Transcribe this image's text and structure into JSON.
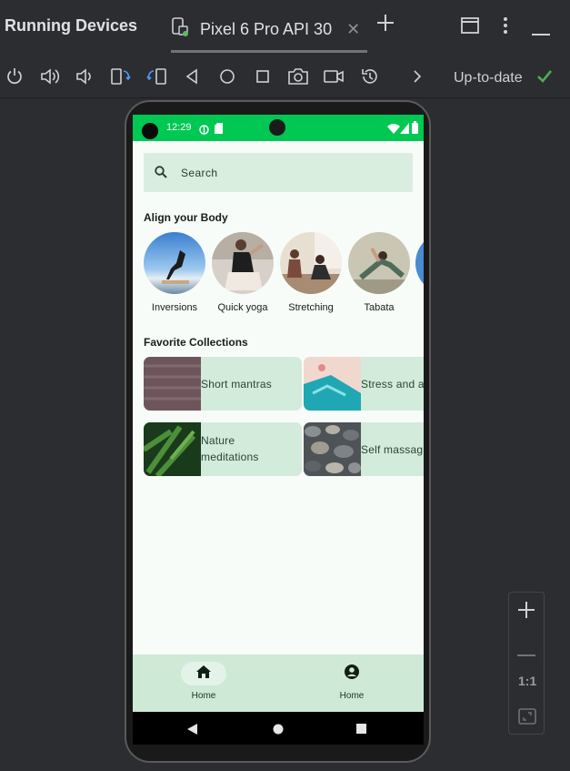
{
  "window": {
    "title": "Running Devices",
    "tab_label": "Pixel 6 Pro API 30",
    "status": "Up-to-date"
  },
  "toolbar": {
    "icons": [
      "power-icon",
      "volume-up-icon",
      "volume-down-icon",
      "rotate-left-icon",
      "rotate-right-icon",
      "back-icon",
      "home-icon",
      "overview-icon",
      "camera-icon",
      "video-icon",
      "reset-icon",
      "chevron-right-icon"
    ],
    "accent_check": "#4caf50"
  },
  "phone": {
    "status_time": "12:29",
    "status_color": "#00c853",
    "search": {
      "placeholder": "Search"
    },
    "section_align": "Align your Body",
    "align_items": [
      {
        "label": "Inversions"
      },
      {
        "label": "Quick yoga"
      },
      {
        "label": "Stretching"
      },
      {
        "label": "Tabata"
      }
    ],
    "section_collections": "Favorite Collections",
    "collections": [
      {
        "label": "Short mantras"
      },
      {
        "label": "Stress and a"
      },
      {
        "label": "Nature meditations"
      },
      {
        "label": "Self massag"
      }
    ],
    "bottom_nav": [
      {
        "label": "Home"
      },
      {
        "label": "Home"
      }
    ]
  },
  "zoom": {
    "actual_size_label": "1:1"
  }
}
